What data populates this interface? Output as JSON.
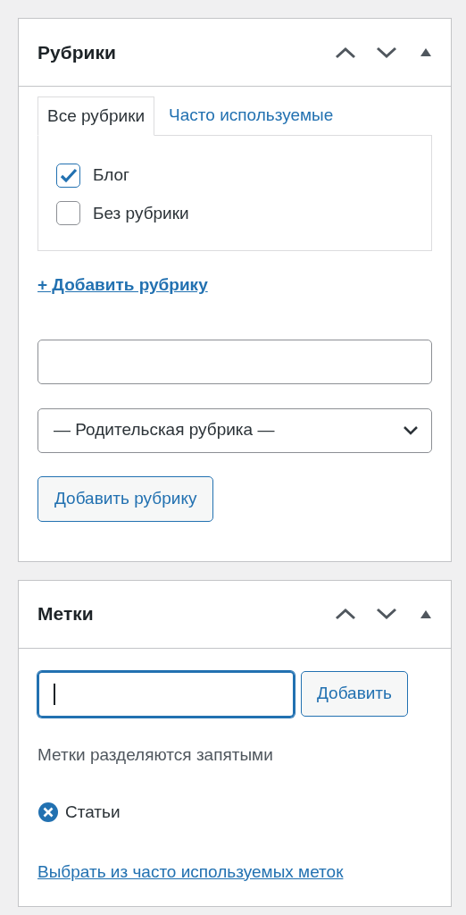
{
  "categories_box": {
    "title": "Рубрики",
    "tabs": [
      {
        "label": "Все рубрики",
        "selected": true
      },
      {
        "label": "Часто используемые",
        "selected": false
      }
    ],
    "items": [
      {
        "label": "Блог",
        "checked": true
      },
      {
        "label": "Без рубрики",
        "checked": false
      }
    ],
    "add_link": "+ Добавить рубрику",
    "parent_select": {
      "value": "— Родительская рубрика —"
    },
    "add_button": "Добавить рубрику"
  },
  "tags_box": {
    "title": "Метки",
    "input": {
      "focused": true
    },
    "add_button": "Добавить",
    "hint": "Метки разделяются запятыми",
    "tags": [
      {
        "label": "Статьи"
      }
    ],
    "choose_link": "Выбрать из часто используемых меток"
  }
}
